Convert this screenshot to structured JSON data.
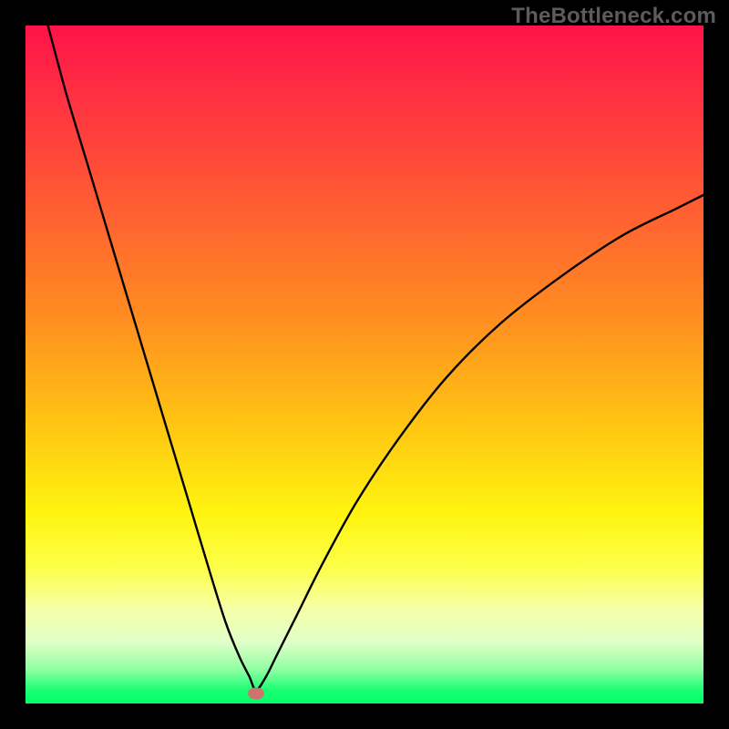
{
  "domain": "Chart",
  "watermark": "TheBottleneck.com",
  "colors": {
    "frame_bg": "#000000",
    "watermark_text": "#5c5c5c",
    "curve_stroke": "#000000",
    "marker_fill": "#c9776e",
    "gradient_stops": [
      "#ff1249",
      "#ff2f42",
      "#ff5834",
      "#ff8a22",
      "#ffc213",
      "#fff40f",
      "#fcff4a",
      "#f6ffa6",
      "#e0ffc8",
      "#8fffa1",
      "#1cff74",
      "#00ff66"
    ]
  },
  "chart_data": {
    "type": "line",
    "title": "",
    "xlabel": "",
    "ylabel": "",
    "xlim": [
      0,
      1
    ],
    "ylim": [
      0,
      1
    ],
    "note": "Axes are unlabeled; values are normalized plot coordinates (0,0 = top-left of plot area, 1,1 = bottom-right).",
    "series": [
      {
        "name": "bottleneck-curve",
        "x": [
          0.033,
          0.06,
          0.09,
          0.12,
          0.15,
          0.18,
          0.21,
          0.24,
          0.27,
          0.295,
          0.315,
          0.33,
          0.34,
          0.355,
          0.37,
          0.4,
          0.44,
          0.49,
          0.55,
          0.62,
          0.7,
          0.79,
          0.88,
          0.96,
          1.0
        ],
        "y": [
          0.0,
          0.1,
          0.2,
          0.3,
          0.4,
          0.5,
          0.6,
          0.7,
          0.8,
          0.88,
          0.93,
          0.96,
          0.98,
          0.96,
          0.93,
          0.87,
          0.79,
          0.7,
          0.61,
          0.52,
          0.44,
          0.37,
          0.31,
          0.27,
          0.25
        ]
      }
    ],
    "marker": {
      "x": 0.34,
      "y": 0.985,
      "label": "optimal-point"
    }
  }
}
